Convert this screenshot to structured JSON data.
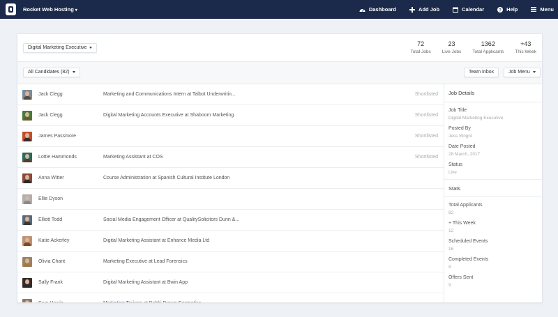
{
  "app": {
    "brand": "Rocket Web Hosting"
  },
  "nav": [
    {
      "label": "Dashboard",
      "icon": "dashboard-icon"
    },
    {
      "label": "Add Job",
      "icon": "plus-icon"
    },
    {
      "label": "Calendar",
      "icon": "calendar-icon"
    },
    {
      "label": "Help",
      "icon": "help-icon"
    },
    {
      "label": "Menu",
      "icon": "hamburger-icon"
    }
  ],
  "job_select": "Digital Marketing Executive",
  "stats": [
    {
      "value": "72",
      "label": "Total Jobs"
    },
    {
      "value": "23",
      "label": "Live Jobs"
    },
    {
      "value": "1362",
      "label": "Total Applicants"
    },
    {
      "value": "+43",
      "label": "This Week"
    }
  ],
  "toolbar": {
    "filter": "All Candidates (82)",
    "team_inbox": "Team Inbox",
    "job_menu": "Job Menu"
  },
  "candidates": [
    {
      "name": "Jack Clegg",
      "position": "Marketing and Communications Intern at Talbot Underwritin...",
      "status": "Shortlisted"
    },
    {
      "name": "Jack Clegg",
      "position": "Digital Marketing Accounts Executive at Shaboom Marketing",
      "status": "Shortlisted"
    },
    {
      "name": "James Passmore",
      "position": "",
      "status": "Shortlisted"
    },
    {
      "name": "Lottie Hammonds",
      "position": "Marketing Assistant at COS",
      "status": "Shortlisted"
    },
    {
      "name": "Anna Witter",
      "position": "Course Administration at Spanish Cultural Institute London",
      "status": ""
    },
    {
      "name": "Ellie Dyson",
      "position": "",
      "status": ""
    },
    {
      "name": "Elliott Todd",
      "position": "Social Media Engagement Officer at QualitySolicitors Dunn &...",
      "status": ""
    },
    {
      "name": "Katie Ackerley",
      "position": "Digital Marketing Assistant at Enhance Media Ltd",
      "status": ""
    },
    {
      "name": "Olivia Chant",
      "position": "Marketing Executive at Lead Forensics",
      "status": ""
    },
    {
      "name": "Sally Frank",
      "position": "Digital Marketing Assistant at Bwin App",
      "status": ""
    },
    {
      "name": "Sam Unwin",
      "position": "Marketing Trainee at Bobbi Brown Cosmetics",
      "status": ""
    }
  ],
  "job_details": {
    "heading": "Job Details",
    "fields": [
      {
        "label": "Job Title",
        "value": "Digital Marketing Executive"
      },
      {
        "label": "Posted By",
        "value": "Jess Wright"
      },
      {
        "label": "Date Posted",
        "value": "28 March, 2017"
      },
      {
        "label": "Status",
        "value": "Live"
      }
    ]
  },
  "job_stats": {
    "heading": "Stats",
    "fields": [
      {
        "label": "Total Applicants",
        "value": "82"
      },
      {
        "label": "+ This Week",
        "value": "12"
      },
      {
        "label": "Scheduled Events",
        "value": "16"
      },
      {
        "label": "Completed Events",
        "value": "8"
      },
      {
        "label": "Offers Sent",
        "value": "9"
      }
    ]
  },
  "colors": {
    "nav_bg": "#1b2a4a",
    "page_bg": "#eef1f6"
  }
}
